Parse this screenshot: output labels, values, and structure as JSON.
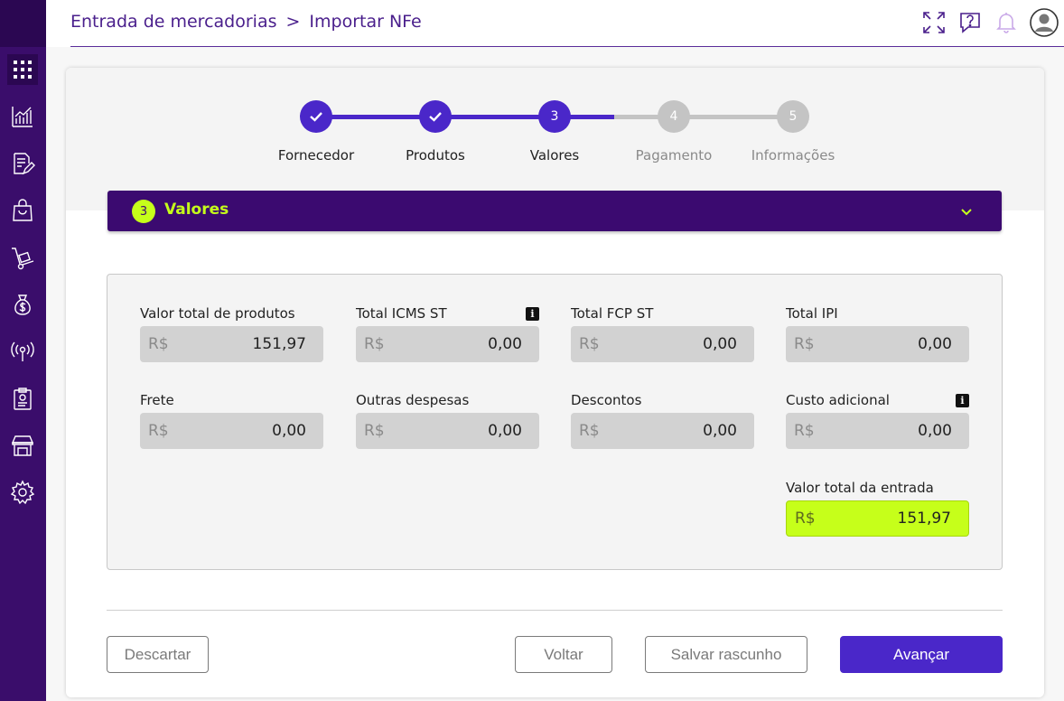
{
  "breadcrumb": {
    "parent": "Entrada de mercadorias",
    "separator": ">",
    "current": "Importar NFe"
  },
  "sidebar": {
    "items": [
      {
        "icon": "apps-grid-icon"
      },
      {
        "icon": "chart-icon"
      },
      {
        "icon": "document-edit-icon"
      },
      {
        "icon": "shopping-bag-icon"
      },
      {
        "icon": "hand-truck-icon"
      },
      {
        "icon": "money-bag-icon"
      },
      {
        "icon": "broadcast-icon"
      },
      {
        "icon": "clipboard-icon"
      },
      {
        "icon": "store-icon"
      },
      {
        "icon": "gear-icon"
      }
    ]
  },
  "stepper": {
    "steps": [
      {
        "number": "1",
        "label": "Fornecedor",
        "status": "done"
      },
      {
        "number": "2",
        "label": "Produtos",
        "status": "done"
      },
      {
        "number": "3",
        "label": "Valores",
        "status": "active"
      },
      {
        "number": "4",
        "label": "Pagamento",
        "status": "pending"
      },
      {
        "number": "5",
        "label": "Informações",
        "status": "pending"
      }
    ]
  },
  "section": {
    "number": "3",
    "title": "Valores"
  },
  "fields": {
    "currency": "R$",
    "valor_total_produtos": {
      "label": "Valor total de produtos",
      "value": "151,97"
    },
    "total_icms_st": {
      "label": "Total ICMS ST",
      "value": "0,00"
    },
    "total_fcp_st": {
      "label": "Total FCP ST",
      "value": "0,00"
    },
    "total_ipi": {
      "label": "Total IPI",
      "value": "0,00"
    },
    "frete": {
      "label": "Frete",
      "value": "0,00"
    },
    "outras_despesas": {
      "label": "Outras despesas",
      "value": "0,00"
    },
    "descontos": {
      "label": "Descontos",
      "value": "0,00"
    },
    "custo_adicional": {
      "label": "Custo adicional",
      "value": "0,00"
    },
    "valor_total_entrada": {
      "label": "Valor total da entrada",
      "value": "151,97"
    }
  },
  "info_glyph": "i",
  "buttons": {
    "descartar": "Descartar",
    "voltar": "Voltar",
    "salvar_rascunho": "Salvar rascunho",
    "avancar": "Avançar"
  },
  "colors": {
    "brand_purple": "#3b0a70",
    "accent_lime": "#c6ff1a",
    "primary_button": "#4a27c9",
    "step_done": "#4a27c9",
    "step_pending": "#c4c4c4"
  }
}
